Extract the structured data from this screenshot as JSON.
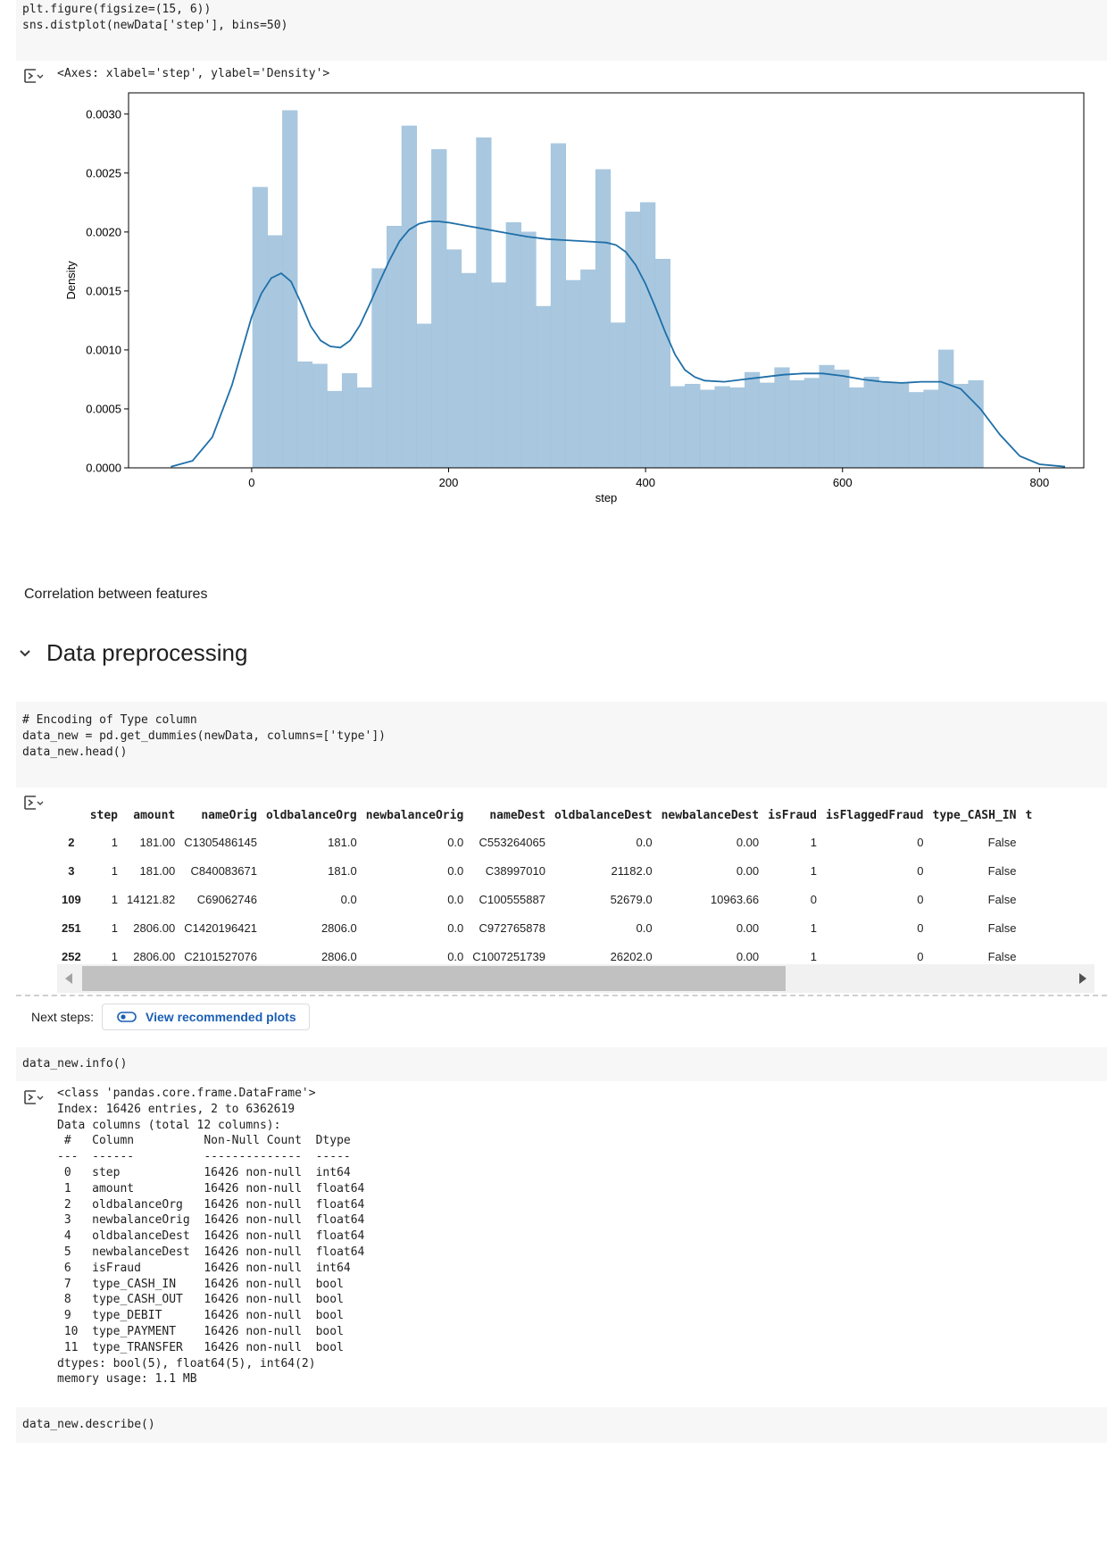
{
  "cell1": {
    "code": [
      "plt.figure(figsize=(15, 6))",
      "sns.distplot(newData['step'], bins=50)"
    ],
    "output_repr": "<Axes: xlabel='step', ylabel='Density'>"
  },
  "chart_data": {
    "type": "bar",
    "title": "",
    "xlabel": "step",
    "ylabel": "Density",
    "xlim": [
      -125,
      845
    ],
    "ylim": [
      0,
      0.00318
    ],
    "x_ticks": [
      0,
      200,
      400,
      600,
      800
    ],
    "x_tick_labels": [
      "0",
      "200",
      "400",
      "600",
      "800"
    ],
    "y_ticks": [
      0,
      0.0005,
      0.001,
      0.0015,
      0.002,
      0.0025,
      0.003
    ],
    "y_tick_labels": [
      "0.0000",
      "0.0005",
      "0.0010",
      "0.0015",
      "0.0020",
      "0.0025",
      "0.0030"
    ],
    "bin_start": 1,
    "bin_end": 743,
    "bins": 50,
    "histogram_values": [
      0.00238,
      0.00197,
      0.00303,
      0.0009,
      0.00088,
      0.00065,
      0.0008,
      0.00068,
      0.00169,
      0.00205,
      0.0029,
      0.00122,
      0.0027,
      0.00185,
      0.00165,
      0.0028,
      0.00157,
      0.00208,
      0.002,
      0.00137,
      0.00275,
      0.00159,
      0.00168,
      0.00253,
      0.00123,
      0.00217,
      0.00225,
      0.00177,
      0.00069,
      0.00071,
      0.00066,
      0.00069,
      0.00068,
      0.00081,
      0.00072,
      0.00085,
      0.00074,
      0.00076,
      0.00087,
      0.00083,
      0.00068,
      0.00077,
      0.00072,
      0.00072,
      0.00064,
      0.00066,
      0.001,
      0.00071,
      0.00074
    ],
    "kde": {
      "x": [
        -82,
        -60,
        -40,
        -20,
        0,
        10,
        20,
        30,
        40,
        50,
        60,
        70,
        80,
        90,
        100,
        110,
        120,
        130,
        140,
        150,
        160,
        170,
        180,
        190,
        200,
        220,
        240,
        260,
        280,
        300,
        320,
        340,
        360,
        370,
        380,
        390,
        400,
        410,
        420,
        430,
        440,
        450,
        460,
        480,
        500,
        520,
        540,
        560,
        580,
        600,
        620,
        640,
        660,
        680,
        700,
        720,
        740,
        760,
        780,
        800,
        826
      ],
      "y": [
        1e-05,
        6e-05,
        0.00026,
        0.0007,
        0.00128,
        0.00148,
        0.00161,
        0.00165,
        0.00158,
        0.0014,
        0.0012,
        0.00108,
        0.00103,
        0.00102,
        0.00108,
        0.00121,
        0.00139,
        0.00158,
        0.00176,
        0.00192,
        0.00202,
        0.00207,
        0.00209,
        0.00209,
        0.00208,
        0.00205,
        0.00202,
        0.00199,
        0.00196,
        0.00194,
        0.00193,
        0.00192,
        0.00191,
        0.00189,
        0.00183,
        0.00172,
        0.00156,
        0.00136,
        0.00115,
        0.00096,
        0.00083,
        0.00077,
        0.00074,
        0.00073,
        0.00075,
        0.00077,
        0.00079,
        0.0008,
        0.0008,
        0.00078,
        0.00075,
        0.00073,
        0.00072,
        0.00073,
        0.00073,
        0.00067,
        0.0005,
        0.00028,
        0.0001,
        3e-05,
        1e-05
      ]
    },
    "colors": {
      "bars": "#a9c8e0",
      "bar_edge": "#a0c2dc",
      "kde": "#1f6fa8"
    },
    "grid": false,
    "legend": "none"
  },
  "markdown_text": "Correlation between features",
  "section_title": "Data preprocessing",
  "cell2": {
    "code": [
      "# Encoding of Type column",
      "data_new = pd.get_dummies(newData, columns=['type'])",
      "data_new.head()"
    ]
  },
  "table": {
    "columns": [
      "",
      "step",
      "amount",
      "nameOrig",
      "oldbalanceOrg",
      "newbalanceOrig",
      "nameDest",
      "oldbalanceDest",
      "newbalanceDest",
      "isFraud",
      "isFlaggedFraud",
      "type_CASH_IN",
      "t"
    ],
    "rows": [
      [
        "2",
        "1",
        "181.00",
        "C1305486145",
        "181.0",
        "0.0",
        "C553264065",
        "0.0",
        "0.00",
        "1",
        "0",
        "False",
        ""
      ],
      [
        "3",
        "1",
        "181.00",
        "C840083671",
        "181.0",
        "0.0",
        "C38997010",
        "21182.0",
        "0.00",
        "1",
        "0",
        "False",
        ""
      ],
      [
        "109",
        "1",
        "14121.82",
        "C69062746",
        "0.0",
        "0.0",
        "C100555887",
        "52679.0",
        "10963.66",
        "0",
        "0",
        "False",
        ""
      ],
      [
        "251",
        "1",
        "2806.00",
        "C1420196421",
        "2806.0",
        "0.0",
        "C972765878",
        "0.0",
        "0.00",
        "1",
        "0",
        "False",
        ""
      ],
      [
        "252",
        "1",
        "2806.00",
        "C2101527076",
        "2806.0",
        "0.0",
        "C1007251739",
        "26202.0",
        "0.00",
        "1",
        "0",
        "False",
        ""
      ]
    ]
  },
  "next_steps": {
    "label": "Next steps:",
    "button": "View recommended plots"
  },
  "cell3": {
    "code": [
      "data_new.info()"
    ]
  },
  "info_output": [
    "<class 'pandas.core.frame.DataFrame'>",
    "Index: 16426 entries, 2 to 6362619",
    "Data columns (total 12 columns):",
    " #   Column          Non-Null Count  Dtype  ",
    "---  ------          --------------  -----  ",
    " 0   step            16426 non-null  int64  ",
    " 1   amount          16426 non-null  float64",
    " 2   oldbalanceOrg   16426 non-null  float64",
    " 3   newbalanceOrig  16426 non-null  float64",
    " 4   oldbalanceDest  16426 non-null  float64",
    " 5   newbalanceDest  16426 non-null  float64",
    " 6   isFraud         16426 non-null  int64  ",
    " 7   type_CASH_IN    16426 non-null  bool   ",
    " 8   type_CASH_OUT   16426 non-null  bool   ",
    " 9   type_DEBIT      16426 non-null  bool   ",
    " 10  type_PAYMENT    16426 non-null  bool   ",
    " 11  type_TRANSFER   16426 non-null  bool   ",
    "dtypes: bool(5), float64(5), int64(2)",
    "memory usage: 1.1 MB"
  ],
  "cell4": {
    "code": [
      "data_new.describe()"
    ]
  }
}
